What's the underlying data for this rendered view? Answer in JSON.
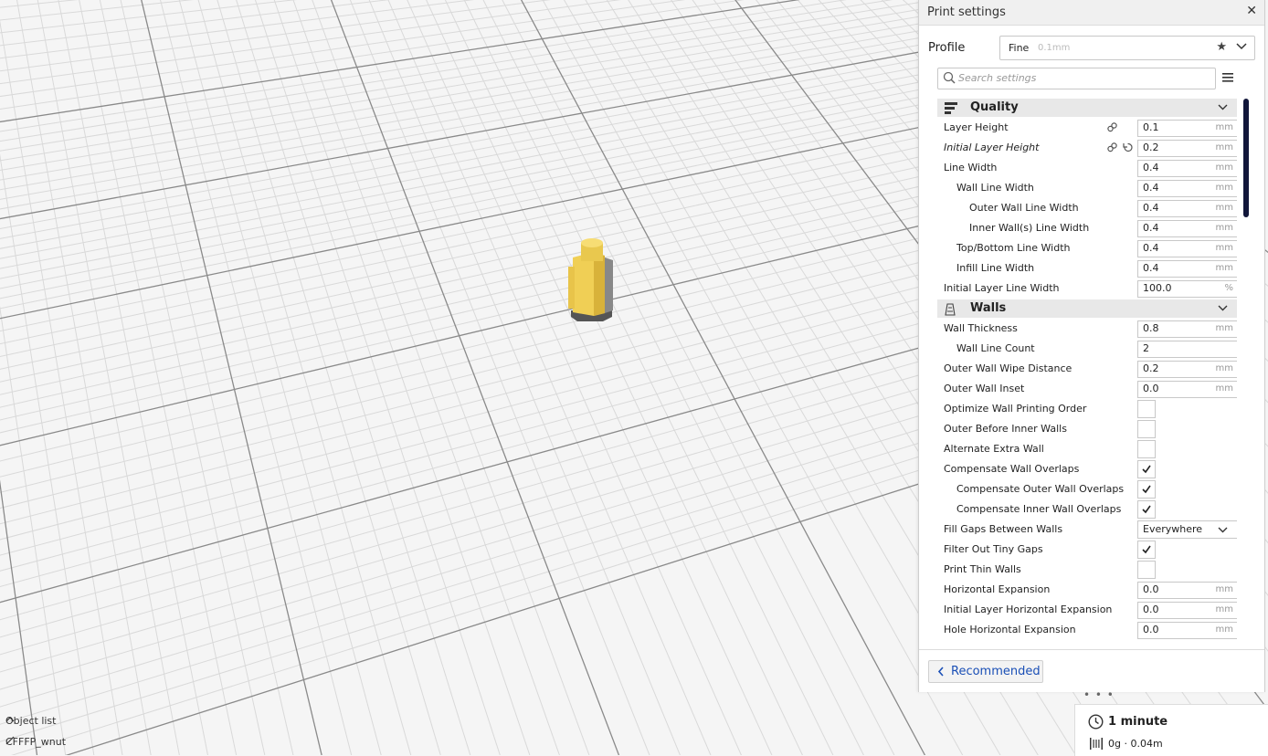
{
  "viewport": {
    "bottom_left": {
      "object_list_label": "Object list",
      "file_name": "CFFFP_wnut"
    }
  },
  "panel": {
    "title": "Print settings",
    "close_glyph": "✕",
    "profile": {
      "label": "Profile",
      "name": "Fine",
      "layer": "0.1mm",
      "star_glyph": "★"
    },
    "search": {
      "placeholder": "Search settings",
      "value": ""
    },
    "categories": [
      {
        "label": "Quality",
        "icon": "quality-icon",
        "settings": [
          {
            "label": "Layer Height",
            "value": "0.1",
            "unit": "mm",
            "type": "field",
            "indent": 0,
            "icons": [
              "link-icon"
            ]
          },
          {
            "label": "Initial Layer Height",
            "value": "0.2",
            "unit": "mm",
            "type": "field",
            "indent": 0,
            "italic": true,
            "icons": [
              "link-icon",
              "reset-icon"
            ]
          },
          {
            "label": "Line Width",
            "value": "0.4",
            "unit": "mm",
            "type": "field",
            "indent": 0
          },
          {
            "label": "Wall Line Width",
            "value": "0.4",
            "unit": "mm",
            "type": "field",
            "indent": 1
          },
          {
            "label": "Outer Wall Line Width",
            "value": "0.4",
            "unit": "mm",
            "type": "field",
            "indent": 2
          },
          {
            "label": "Inner Wall(s) Line Width",
            "value": "0.4",
            "unit": "mm",
            "type": "field",
            "indent": 2
          },
          {
            "label": "Top/Bottom Line Width",
            "value": "0.4",
            "unit": "mm",
            "type": "field",
            "indent": 1
          },
          {
            "label": "Infill Line Width",
            "value": "0.4",
            "unit": "mm",
            "type": "field",
            "indent": 1
          },
          {
            "label": "Initial Layer Line Width",
            "value": "100.0",
            "unit": "%",
            "type": "field",
            "indent": 0
          }
        ]
      },
      {
        "label": "Walls",
        "icon": "walls-icon",
        "settings": [
          {
            "label": "Wall Thickness",
            "value": "0.8",
            "unit": "mm",
            "type": "field",
            "indent": 0
          },
          {
            "label": "Wall Line Count",
            "value": "2",
            "unit": "",
            "type": "field",
            "indent": 1
          },
          {
            "label": "Outer Wall Wipe Distance",
            "value": "0.2",
            "unit": "mm",
            "type": "field",
            "indent": 0
          },
          {
            "label": "Outer Wall Inset",
            "value": "0.0",
            "unit": "mm",
            "type": "field",
            "indent": 0
          },
          {
            "label": "Optimize Wall Printing Order",
            "checked": false,
            "type": "check",
            "indent": 0
          },
          {
            "label": "Outer Before Inner Walls",
            "checked": false,
            "type": "check",
            "indent": 0
          },
          {
            "label": "Alternate Extra Wall",
            "checked": false,
            "type": "check",
            "indent": 0
          },
          {
            "label": "Compensate Wall Overlaps",
            "checked": true,
            "type": "check",
            "indent": 0
          },
          {
            "label": "Compensate Outer Wall Overlaps",
            "checked": true,
            "type": "check",
            "indent": 1
          },
          {
            "label": "Compensate Inner Wall Overlaps",
            "checked": true,
            "type": "check",
            "indent": 1
          },
          {
            "label": "Fill Gaps Between Walls",
            "value": "Everywhere",
            "type": "select",
            "indent": 0
          },
          {
            "label": "Filter Out Tiny Gaps",
            "checked": true,
            "type": "check",
            "indent": 0
          },
          {
            "label": "Print Thin Walls",
            "checked": false,
            "type": "check",
            "indent": 0
          },
          {
            "label": "Horizontal Expansion",
            "value": "0.0",
            "unit": "mm",
            "type": "field",
            "indent": 0
          },
          {
            "label": "Initial Layer Horizontal Expansion",
            "value": "0.0",
            "unit": "mm",
            "type": "field",
            "indent": 0
          },
          {
            "label": "Hole Horizontal Expansion",
            "value": "0.0",
            "unit": "mm",
            "type": "field",
            "indent": 0
          }
        ]
      }
    ],
    "footer": {
      "recommended_label": "Recommended"
    },
    "drag_handle": "• • •"
  },
  "estimate": {
    "time": "1 minute",
    "material": "0g · 0.04m"
  },
  "colors": {
    "accent_link": "#1a4fb6",
    "scrollbar": "#11163a",
    "model": "#f0d060"
  }
}
